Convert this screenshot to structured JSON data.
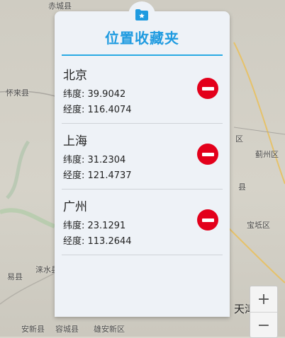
{
  "map": {
    "labels": {
      "chicheng": "赤城县",
      "huailai": "怀来县",
      "yixian": "易县",
      "laishui": "涞水县",
      "anxin": "安新县",
      "rongcheng": "容城县",
      "xiongxian": "雄安新区",
      "qu": "区",
      "jizhou": "蓟州区",
      "baodi": "宝坻区",
      "xiang": "县",
      "tianjin": "天津"
    }
  },
  "dialog": {
    "title": "位置收藏夹",
    "favorites": [
      {
        "city": "北京",
        "lat_label": "纬度: 39.9042",
        "lng_label": "经度: 116.4074"
      },
      {
        "city": "上海",
        "lat_label": "纬度: 31.2304",
        "lng_label": "经度: 121.4737"
      },
      {
        "city": "广州",
        "lat_label": "纬度: 23.1291",
        "lng_label": "经度: 113.2644"
      }
    ]
  },
  "zoom": {
    "in": "+",
    "out": "−"
  },
  "colors": {
    "accent": "#1f9be0",
    "remove": "#e3001b",
    "panel": "#eef2f7"
  },
  "icons": {
    "badge": "folder-star-icon",
    "remove": "minus-circle-icon"
  }
}
